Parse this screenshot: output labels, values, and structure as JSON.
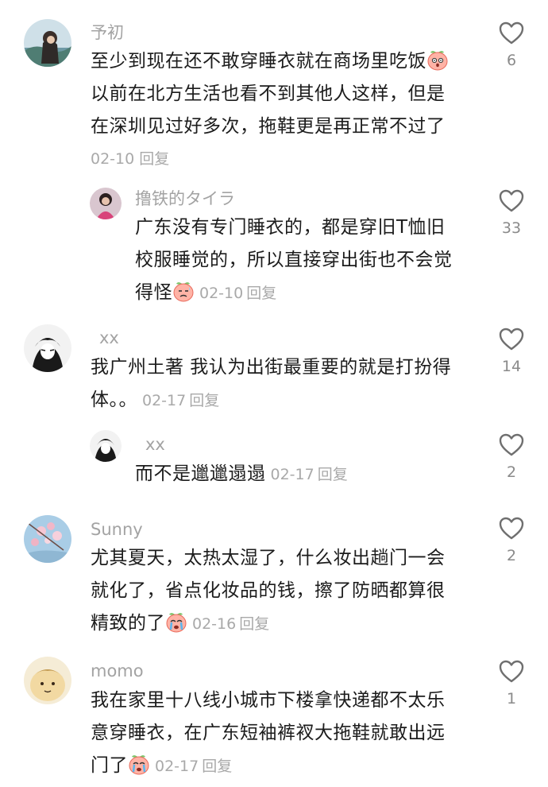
{
  "comments": [
    {
      "username": "予初",
      "text_lines": [
        "至少到现在还不敢穿睡衣就在商场里吃饭",
        "以前在北方生活也看不到其他人这样，但是",
        "在深圳见过好多次，拖鞋更是再正常不过了"
      ],
      "date": "02-10",
      "reply_label": "回复",
      "likes": "6",
      "replies": [
        {
          "username": "撸铁的タイラ",
          "text_lines": [
            "广东没有专门睡衣的，都是穿旧T恤旧",
            "校服睡觉的，所以直接穿出街也不会觉",
            "得怪"
          ],
          "date": "02-10",
          "reply_label": "回复",
          "likes": "33"
        }
      ]
    },
    {
      "username": "xx",
      "text_lines": [
        "我广州土著 我认为出街最重要的就是打扮得",
        "体。。"
      ],
      "date": "02-17",
      "reply_label": "回复",
      "likes": "14",
      "replies": [
        {
          "username": "xx",
          "text_lines": [
            "而不是邋邋遢遢"
          ],
          "date": "02-17",
          "reply_label": "回复",
          "likes": "2"
        }
      ]
    },
    {
      "username": "Sunny",
      "text_lines": [
        "尤其夏天，太热太湿了，什么妆出趟门一会",
        "就化了，省点化妆品的钱，擦了防晒都算很",
        "精致的了"
      ],
      "date": "02-16",
      "reply_label": "回复",
      "likes": "2"
    },
    {
      "username": "momo",
      "text_lines": [
        "我在家里十八线小城市下楼拿快递都不太乐",
        "意穿睡衣，在广东短袖裤衩大拖鞋就敢出远",
        "门了"
      ],
      "date": "02-17",
      "reply_label": "回复",
      "likes": "1"
    }
  ],
  "icons": {
    "like": "heart-outline-icon",
    "emoji_shocked": "shocked-peach-emoji",
    "emoji_awkward": "awkward-peach-emoji",
    "emoji_crying": "crying-peach-emoji"
  },
  "colors": {
    "username": "#a3a3a3",
    "text": "#1c1c1c",
    "meta": "#a9a9a9",
    "like_count": "#8a8a8a"
  }
}
